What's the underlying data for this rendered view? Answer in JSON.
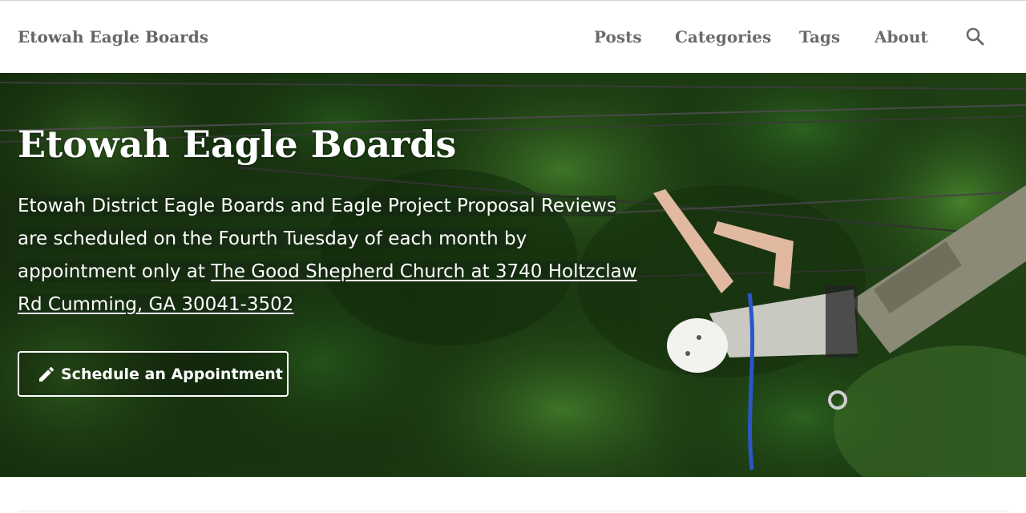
{
  "site": {
    "brand": "Etowah Eagle Boards"
  },
  "nav": {
    "items": [
      "Posts",
      "Categories",
      "Tags",
      "About"
    ],
    "search_icon": "search-icon"
  },
  "hero": {
    "title": "Etowah Eagle Boards",
    "description_text": "Etowah District Eagle Boards and Eagle Project Proposal Reviews are scheduled on the Fourth Tuesday of each month by appointment only at ",
    "location_link": "The Good Shepherd Church at 3740 Holtzclaw Rd Cumming, GA 30041-3502",
    "cta_icon": "pencil-icon",
    "cta_label": "Schedule an Appointment",
    "image": "person on high ropes course among green trees"
  },
  "colors": {
    "nav_text": "#6b6b6b",
    "hero_text": "#ffffff",
    "foliage": "#2c5a1f"
  }
}
